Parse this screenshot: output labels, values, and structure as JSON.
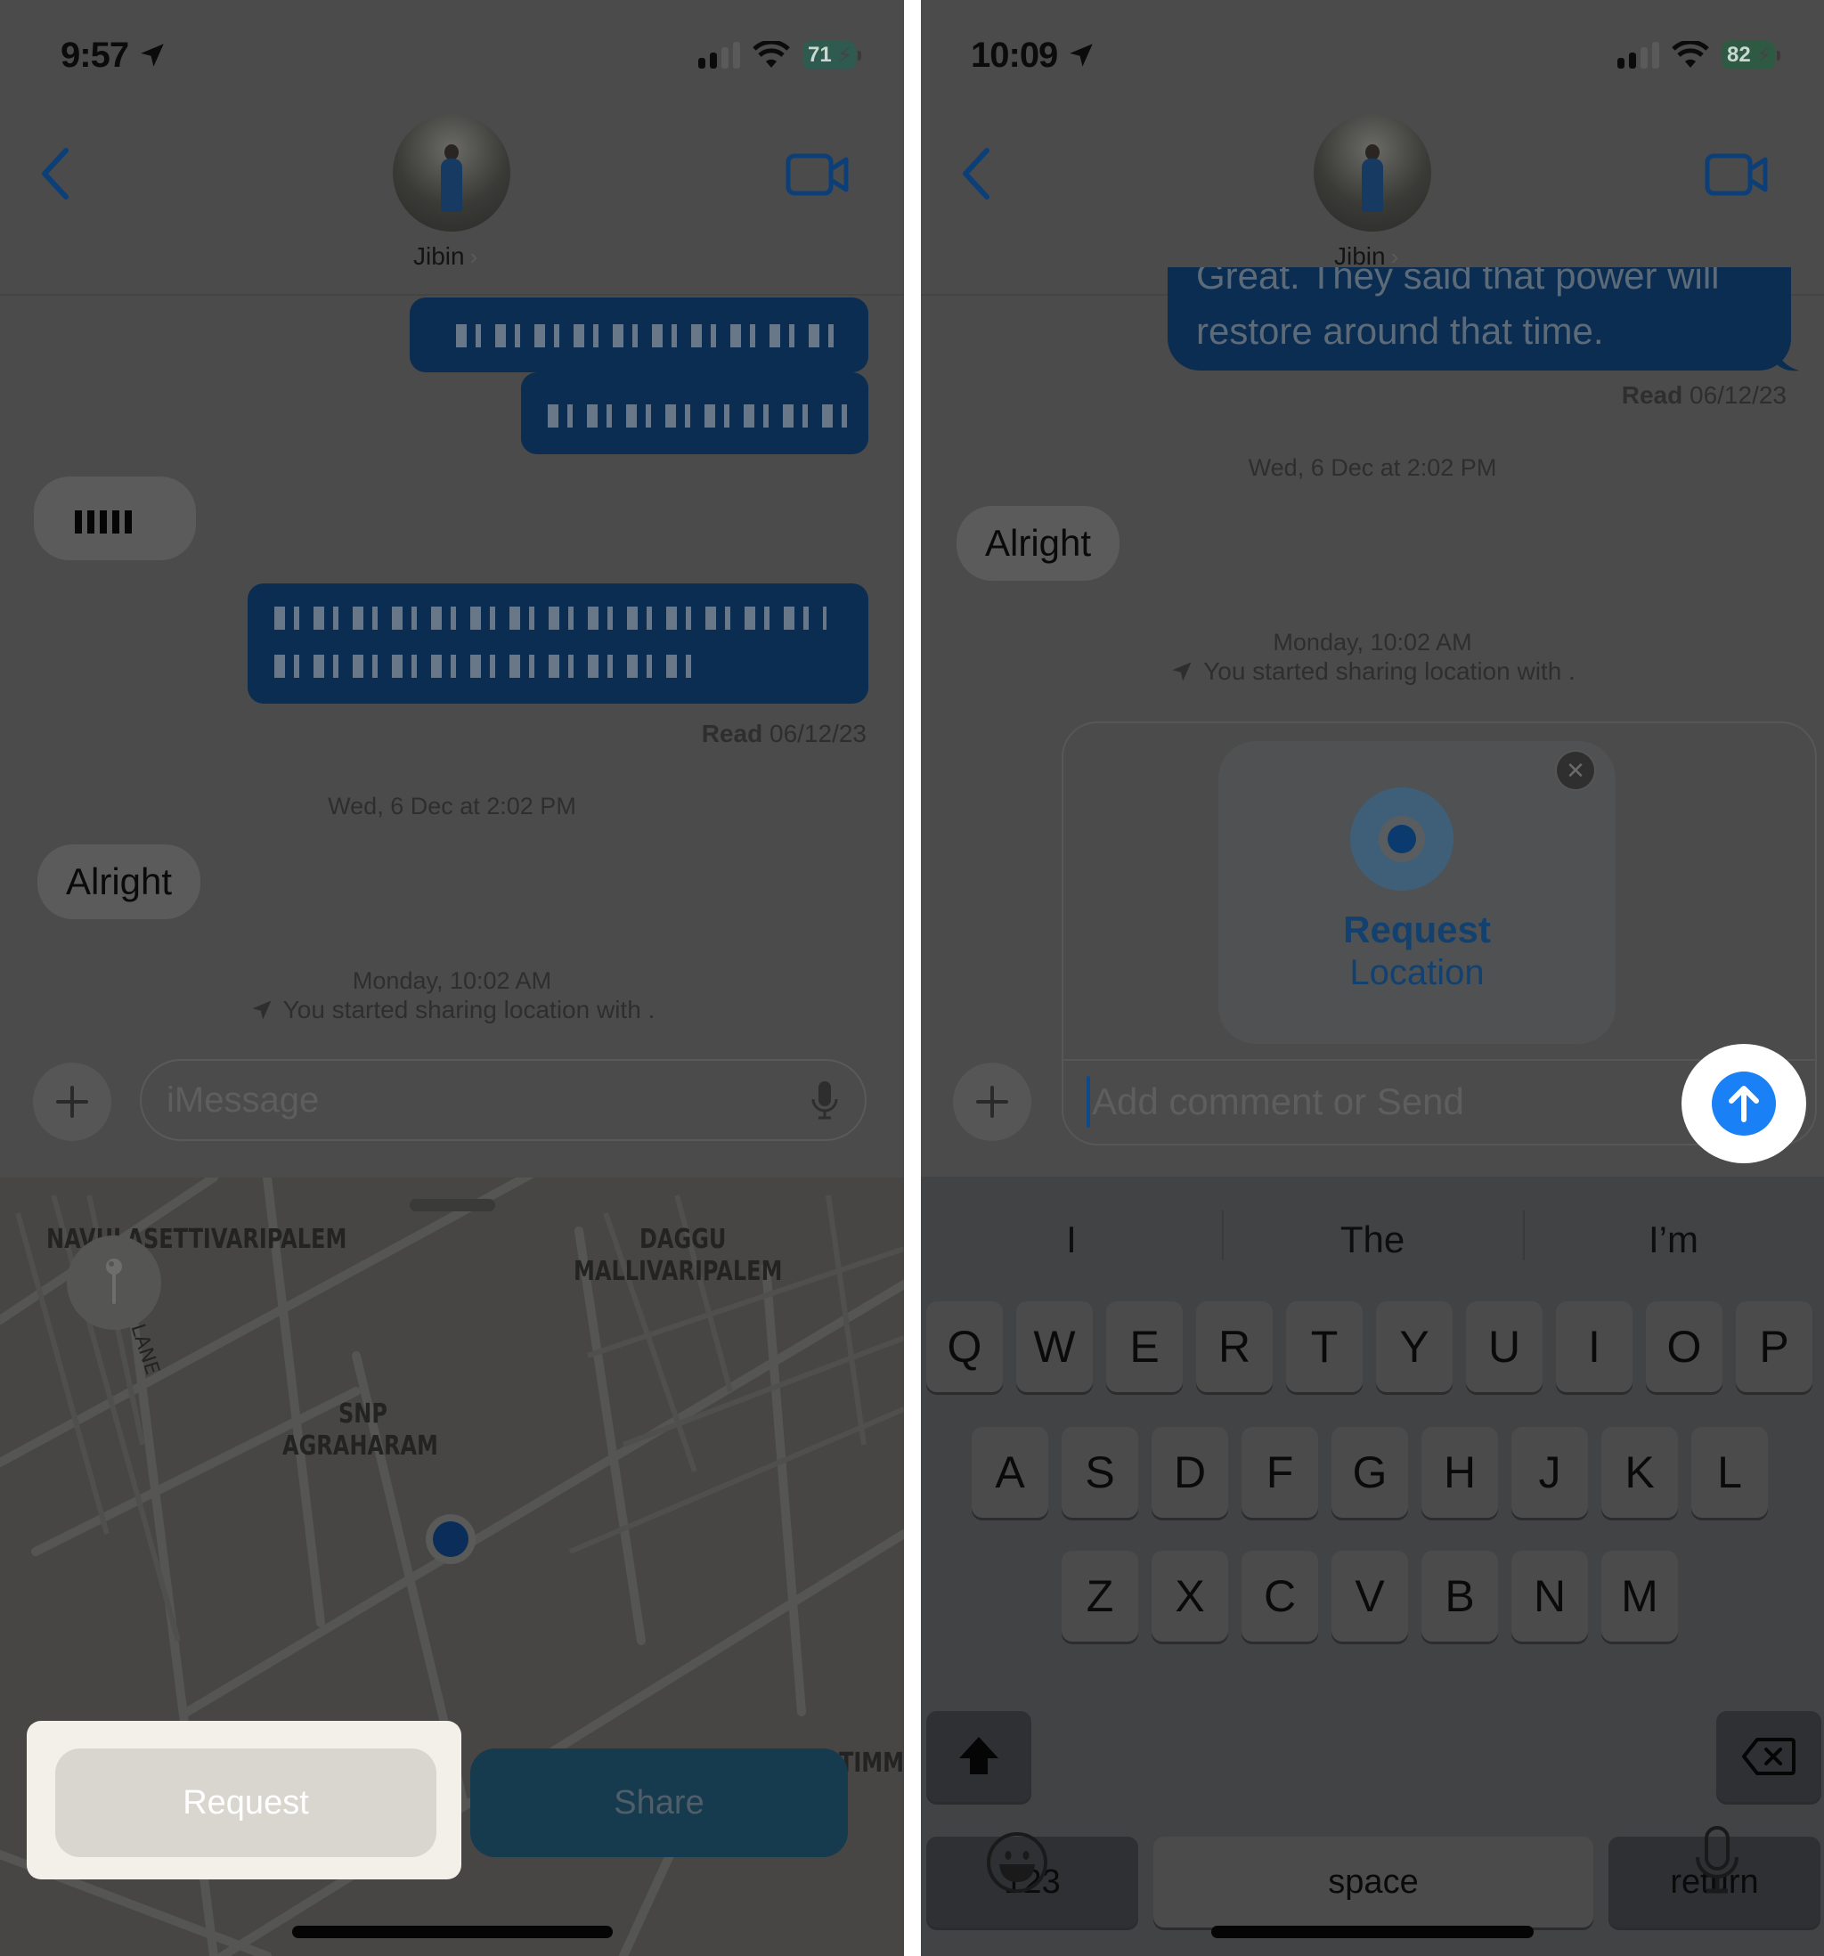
{
  "left": {
    "status_bar": {
      "time": "9:57",
      "battery": "71"
    },
    "header": {
      "contact_name": "Jibin"
    },
    "messages": {
      "read_receipt_label": "Read",
      "read_receipt_date": "06/12/23",
      "timestamp_1": "Wed, 6 Dec at 2:02 PM",
      "incoming_text": "Alright",
      "timestamp_2": "Monday, 10:02 AM",
      "share_notice": "You started sharing location with ."
    },
    "composer": {
      "placeholder": "iMessage"
    },
    "map": {
      "labels": [
        {
          "text": "NAVULASETTIVARIPALEM"
        },
        {
          "text": "DAGGU"
        },
        {
          "text": "MALLIVARIPALEM"
        },
        {
          "text": "SNP"
        },
        {
          "text": "AGRAHARAM"
        },
        {
          "text": "LANE"
        },
        {
          "text": "TIMM"
        }
      ]
    },
    "actions": {
      "request_label": "Request",
      "share_label": "Share"
    }
  },
  "right": {
    "status_bar": {
      "time": "10:09",
      "battery": "82"
    },
    "header": {
      "contact_name": "Jibin"
    },
    "messages": {
      "outgoing_partial_top": "Great. They said that power will",
      "outgoing_text": "restore around that time.",
      "read_receipt_label": "Read",
      "read_receipt_date": "06/12/23",
      "timestamp_1": "Wed, 6 Dec at 2:02 PM",
      "incoming_text": "Alright",
      "timestamp_2": "Monday, 10:02 AM",
      "share_notice": "You started sharing location with ."
    },
    "location_card": {
      "title": "Request",
      "subtitle": "Location"
    },
    "composer": {
      "placeholder": "Add comment or Send"
    },
    "keyboard": {
      "suggestions": [
        "I",
        "The",
        "I’m"
      ],
      "row1": [
        "Q",
        "W",
        "E",
        "R",
        "T",
        "Y",
        "U",
        "I",
        "O",
        "P"
      ],
      "row2": [
        "A",
        "S",
        "D",
        "F",
        "G",
        "H",
        "J",
        "K",
        "L"
      ],
      "row3": [
        "Z",
        "X",
        "C",
        "V",
        "B",
        "N",
        "M"
      ],
      "numbers_label": "123",
      "space_label": "space",
      "return_label": "return"
    }
  },
  "colors": {
    "accent_blue": "#1a80f5",
    "outgoing_bubble": "#0b2d52",
    "highlight": "#ffffff"
  }
}
